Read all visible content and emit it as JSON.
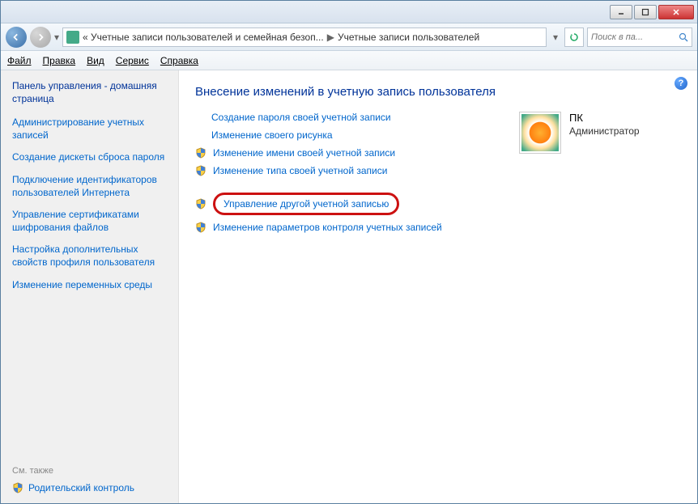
{
  "breadcrumb": {
    "seg1": "« Учетные записи пользователей и семейная безоп...",
    "seg2": "Учетные записи пользователей"
  },
  "search": {
    "placeholder": "Поиск в па..."
  },
  "menu": {
    "file": "Файл",
    "edit": "Правка",
    "view": "Вид",
    "tools": "Сервис",
    "help": "Справка"
  },
  "sidebar": {
    "home": "Панель управления - домашняя страница",
    "items": [
      "Администрирование учетных записей",
      "Создание дискеты сброса пароля",
      "Подключение идентификаторов пользователей Интернета",
      "Управление сертификатами шифрования файлов",
      "Настройка дополнительных свойств профиля пользователя",
      "Изменение переменных среды"
    ],
    "seealso": "См. также",
    "parental": "Родительский контроль"
  },
  "main": {
    "heading": "Внесение изменений в учетную запись пользователя",
    "links": {
      "create_pw": "Создание пароля своей учетной записи",
      "change_pic": "Изменение своего рисунка",
      "change_name": "Изменение имени своей учетной записи",
      "change_type": "Изменение типа своей учетной записи",
      "manage_other": "Управление другой учетной записью",
      "uac": "Изменение параметров контроля учетных записей"
    },
    "user": {
      "name": "ПК",
      "role": "Администратор"
    }
  }
}
